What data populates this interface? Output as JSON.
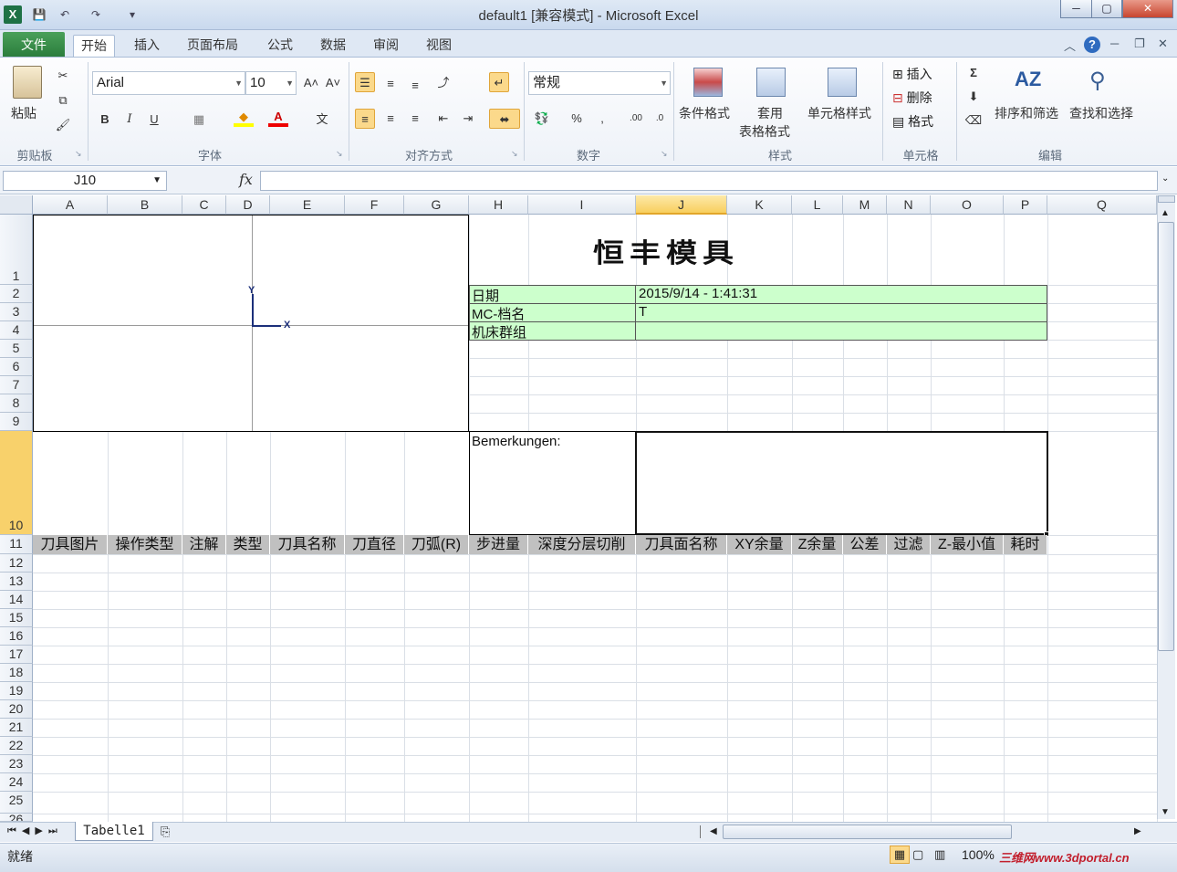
{
  "window": {
    "title": "default1  [兼容模式] - Microsoft Excel",
    "min": "─",
    "max": "▢",
    "close": "✕"
  },
  "app_icon": "X",
  "qat": {
    "save": "💾",
    "undo": "↶",
    "redo": "↷",
    "customize": "▾"
  },
  "tabs": {
    "file": "文件",
    "items": [
      "开始",
      "插入",
      "页面布局",
      "公式",
      "数据",
      "审阅",
      "视图"
    ]
  },
  "ribbon_right": {
    "collapse": "︿",
    "help": "?",
    "min": "─",
    "restore": "❐",
    "close": "✕"
  },
  "ribbon": {
    "clipboard": {
      "label": "剪贴板",
      "paste": "粘贴",
      "cut": "✂",
      "copy": "⧉",
      "format_painter": "🖌"
    },
    "font": {
      "label": "字体",
      "name": "Arial",
      "size": "10",
      "grow": "A˄",
      "shrink": "A˅",
      "bold": "B",
      "italic": "I",
      "underline": "U",
      "border": "▦",
      "fill": "◆",
      "color": "A",
      "phonetic": "文"
    },
    "alignment": {
      "label": "对齐方式"
    },
    "number": {
      "label": "数字",
      "format": "常规",
      "percent": "%",
      "comma": ","
    },
    "styles": {
      "label": "样式",
      "conditional": "条件格式",
      "table_a": "套用",
      "table_b": "表格格式",
      "cell_styles": "单元格样式"
    },
    "cells": {
      "label": "单元格",
      "insert": "插入",
      "delete": "删除",
      "format": "格式"
    },
    "editing": {
      "label": "编辑",
      "sum": "Σ",
      "sort": "排序和筛选",
      "find": "查找和选择"
    }
  },
  "formula_bar": {
    "name_box": "J10",
    "fx": "fx",
    "value": ""
  },
  "columns": [
    "A",
    "B",
    "C",
    "D",
    "E",
    "F",
    "G",
    "H",
    "I",
    "J",
    "K",
    "L",
    "M",
    "N",
    "O",
    "P",
    "Q"
  ],
  "rows": [
    "1",
    "2",
    "3",
    "4",
    "5",
    "6",
    "7",
    "8",
    "9",
    "10",
    "11",
    "12",
    "13",
    "14",
    "15",
    "16",
    "17",
    "18",
    "19",
    "20",
    "21",
    "22",
    "23",
    "24",
    "25",
    "26"
  ],
  "sheet": {
    "company": "恒丰模具",
    "axis_y": "Y",
    "axis_x": "X",
    "date_label": "日期",
    "date_value": "2015/9/14 - 1:41:31",
    "mc_label": "MC-档名",
    "mc_value": "T",
    "machine_label": "机床群组",
    "machine_value": "",
    "remarks_label": "Bemerkungen:",
    "headers": [
      "刀具图片",
      "操作类型",
      "注解",
      "类型",
      "刀具名称",
      "刀直径",
      "刀弧(R)",
      "步进量",
      "深度分层切削",
      "刀具面名称",
      "XY余量",
      "Z余量",
      "公差",
      "过滤",
      "Z-最小值",
      "耗时"
    ]
  },
  "sheet_tabs": {
    "current": "Tabelle1",
    "nav": [
      "⏮",
      "◀",
      "▶",
      "⏭"
    ]
  },
  "status": {
    "ready": "就绪",
    "zoom": "100%",
    "watermark": "三维网www.3dportal.cn"
  }
}
